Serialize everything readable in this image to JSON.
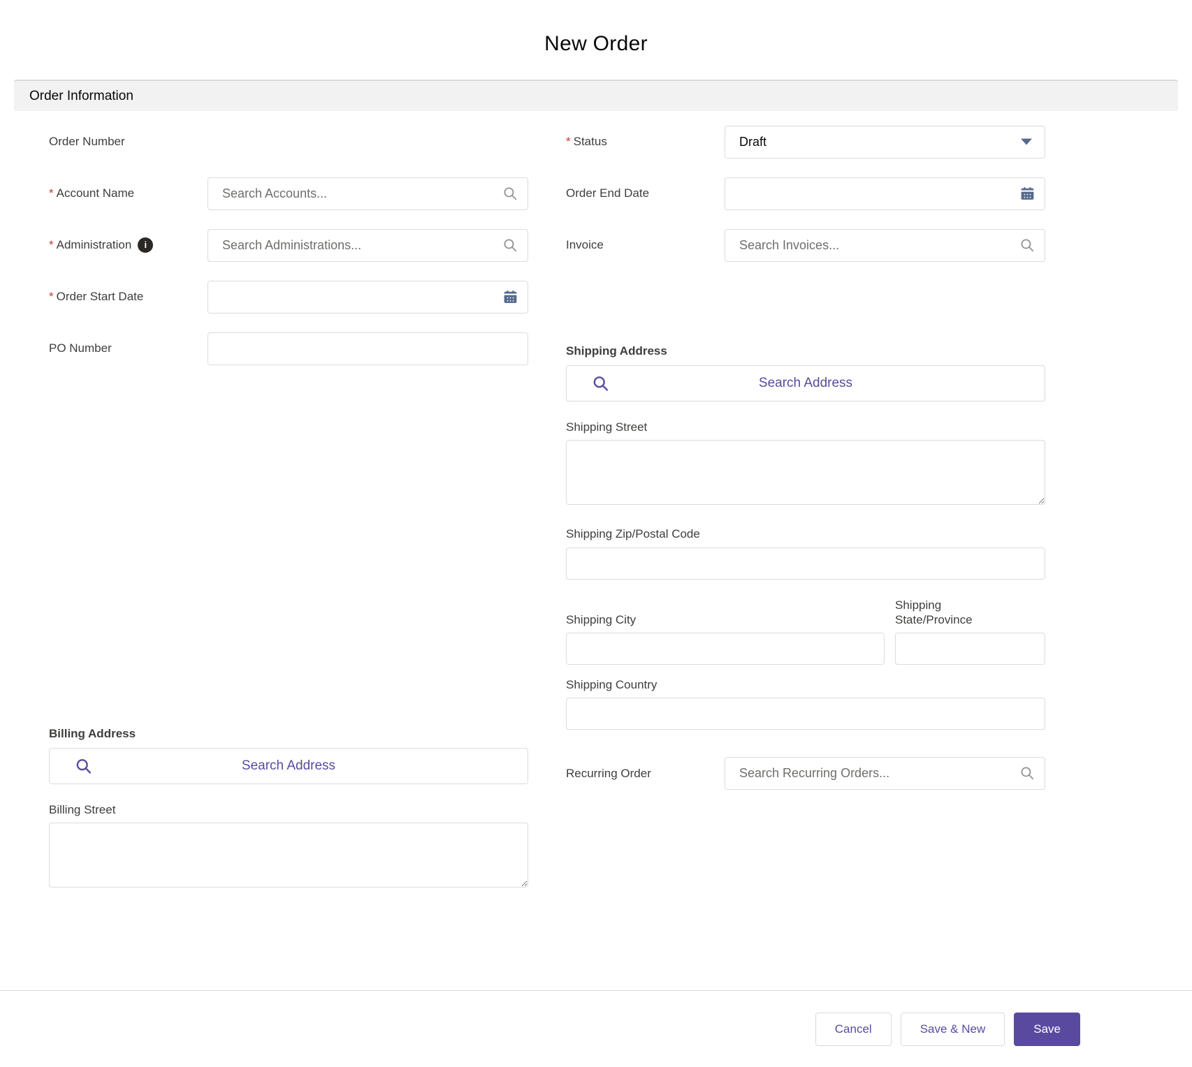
{
  "ui": {
    "required_marker": "*",
    "info_glyph": "i"
  },
  "header": {
    "title": "New Order"
  },
  "section": {
    "title": "Order Information"
  },
  "fields": {
    "order_number": {
      "label": "Order Number"
    },
    "account_name": {
      "label": "Account Name",
      "required": true,
      "placeholder": "Search Accounts..."
    },
    "administration": {
      "label": "Administration",
      "required": true,
      "placeholder": "Search Administrations..."
    },
    "order_start_date": {
      "label": "Order Start Date",
      "required": true
    },
    "po_number": {
      "label": "PO Number"
    },
    "status": {
      "label": "Status",
      "required": true,
      "value": "Draft"
    },
    "order_end_date": {
      "label": "Order End Date"
    },
    "invoice": {
      "label": "Invoice",
      "placeholder": "Search Invoices..."
    },
    "recurring_order": {
      "label": "Recurring Order",
      "placeholder": "Search Recurring Orders..."
    }
  },
  "shipping_address": {
    "heading": "Shipping Address",
    "search_button_label": "Search Address",
    "street_label": "Shipping Street",
    "zip_label": "Shipping Zip/Postal Code",
    "city_label": "Shipping City",
    "state_label": "Shipping State/Province",
    "country_label": "Shipping Country"
  },
  "billing_address": {
    "heading": "Billing Address",
    "search_button_label": "Search Address",
    "street_label": "Billing Street"
  },
  "footer": {
    "cancel_label": "Cancel",
    "save_new_label": "Save & New",
    "save_label": "Save"
  },
  "colors": {
    "accent_purple": "#5a4a9f",
    "required_red": "#c23934",
    "icon_slate_blue": "#54698d",
    "section_header_bg": "#f3f2f2",
    "input_border": "#dddbda"
  }
}
